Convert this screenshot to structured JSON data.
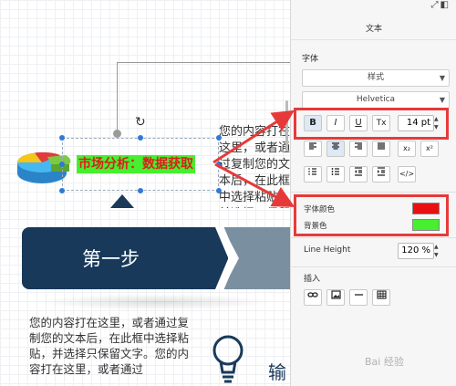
{
  "canvas": {
    "title_text": "市场分析：数据获取",
    "step_label": "第一步",
    "paragraph_top": "您的内容打在这里，或者通过复制您的文本后，在此框中选择粘贴，并选择只保留文字。",
    "paragraph_bottom": "您的内容打在这里，或者通过复制您的文本后，在此框中选择粘贴，并选择只保留文字。您的内容打在这里，或者通过",
    "bottom_heading": "输"
  },
  "panel": {
    "tab": "文本",
    "font_section": "字体",
    "style_select": "样式",
    "font_select": "Helvetica",
    "bold": "B",
    "italic": "I",
    "underline": "U",
    "clear_format": "Tx",
    "font_size": "14 pt",
    "subscript": "x₂",
    "superscript": "x²",
    "html": "</>",
    "font_color_label": "字体颜色",
    "bg_color_label": "背景色",
    "font_color": "#e81010",
    "bg_color": "#46ef2f",
    "line_height_label": "Line Height",
    "line_height": "120 %",
    "insert_section": "插入"
  },
  "colors": {
    "accent_red": "#e63a3a",
    "banner_navy": "#18395a",
    "selection_blue": "#2f7ad7"
  }
}
